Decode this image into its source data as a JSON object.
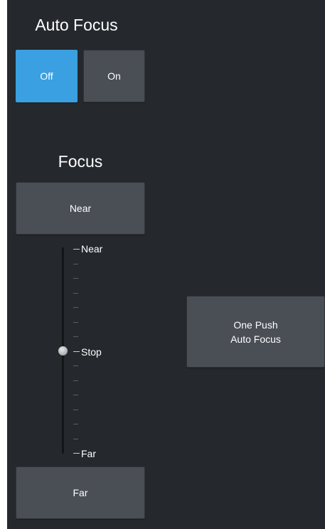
{
  "auto_focus": {
    "title": "Auto Focus",
    "off_label": "Off",
    "on_label": "On",
    "selected": "Off",
    "active_color": "#3aa0e1"
  },
  "focus": {
    "title": "Focus",
    "near_button_label": "Near",
    "far_button_label": "Far",
    "slider": {
      "top_label": "Near",
      "middle_label": "Stop",
      "bottom_label": "Far",
      "position": 0.5
    }
  },
  "one_push_label": "One Push\nAuto Focus"
}
